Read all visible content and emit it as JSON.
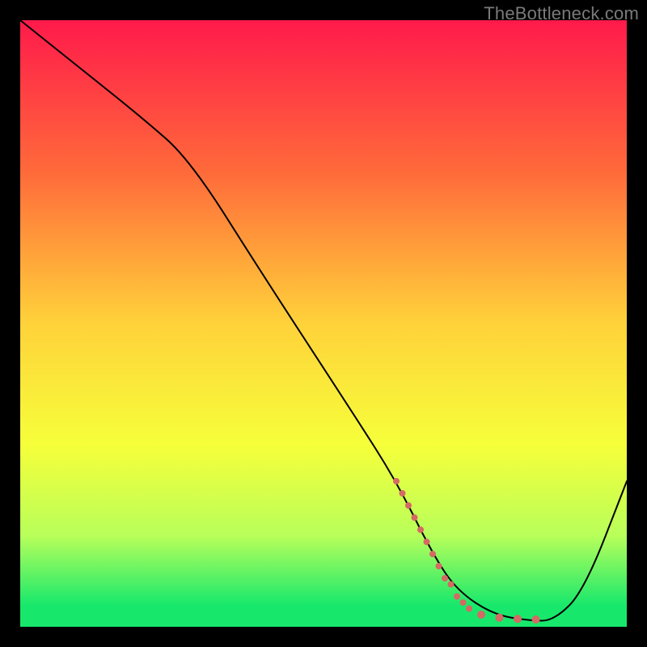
{
  "watermark": "TheBottleneck.com",
  "chart_data": {
    "type": "line",
    "title": "",
    "xlabel": "",
    "ylabel": "",
    "xlim": [
      0,
      100
    ],
    "ylim": [
      0,
      100
    ],
    "grid": false,
    "legend": false,
    "background_gradient": {
      "stops": [
        {
          "offset": 0.0,
          "color": "#ff1a4b"
        },
        {
          "offset": 0.25,
          "color": "#ff6a3a"
        },
        {
          "offset": 0.5,
          "color": "#ffd23a"
        },
        {
          "offset": 0.7,
          "color": "#f6ff3a"
        },
        {
          "offset": 0.85,
          "color": "#b8ff5a"
        },
        {
          "offset": 0.965,
          "color": "#17e86c"
        },
        {
          "offset": 1.0,
          "color": "#17e86c"
        }
      ]
    },
    "series": [
      {
        "name": "bottleneck-curve",
        "color": "#000000",
        "width": 2,
        "x": [
          0,
          10,
          20,
          28,
          40,
          55,
          62,
          68,
          72,
          78,
          84,
          88,
          93,
          100
        ],
        "y": [
          100,
          92,
          84,
          77,
          58,
          35,
          24,
          12,
          6,
          2,
          1,
          1,
          6,
          24
        ]
      }
    ],
    "markers": {
      "name": "highlight-dots",
      "color": "#d46a63",
      "points": [
        {
          "x": 62,
          "y": 24,
          "r": 4
        },
        {
          "x": 63,
          "y": 22,
          "r": 4
        },
        {
          "x": 64,
          "y": 20,
          "r": 4
        },
        {
          "x": 65,
          "y": 18,
          "r": 4
        },
        {
          "x": 66,
          "y": 16,
          "r": 4
        },
        {
          "x": 67,
          "y": 14,
          "r": 4
        },
        {
          "x": 68,
          "y": 12,
          "r": 4
        },
        {
          "x": 69,
          "y": 10,
          "r": 4
        },
        {
          "x": 70,
          "y": 8,
          "r": 4
        },
        {
          "x": 71,
          "y": 7,
          "r": 4
        },
        {
          "x": 72,
          "y": 5,
          "r": 4
        },
        {
          "x": 73,
          "y": 4,
          "r": 4
        },
        {
          "x": 74,
          "y": 3,
          "r": 4
        },
        {
          "x": 76,
          "y": 2,
          "r": 5
        },
        {
          "x": 79,
          "y": 1.5,
          "r": 5
        },
        {
          "x": 82,
          "y": 1.3,
          "r": 5
        },
        {
          "x": 85,
          "y": 1.2,
          "r": 5
        }
      ]
    }
  }
}
